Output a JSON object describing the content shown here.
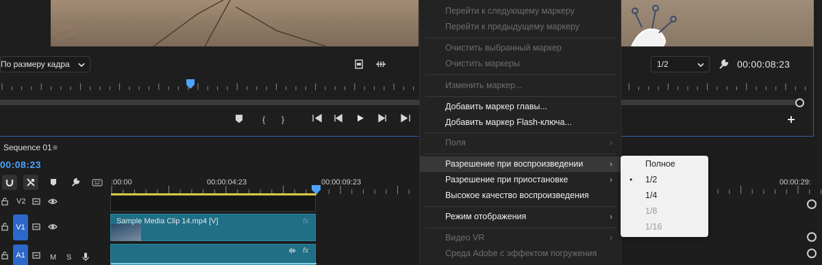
{
  "monitor": {
    "fit_dropdown": "По размеру кадра",
    "resolution_dropdown": "1/2",
    "timecode": "00:00:08:23"
  },
  "timeline": {
    "sequence_tab": "Sequence 01",
    "menu_glyph": "≡",
    "current_timecode": "00:08:23",
    "ruler_labels": [
      ":00:00",
      "00:00:04:23",
      "00:00:09:23",
      "00:00:29:"
    ],
    "tracks": [
      {
        "name": "V2"
      },
      {
        "name": "V1"
      },
      {
        "name": "A1",
        "m": "M",
        "s": "S"
      }
    ],
    "clip_title": "Sample Media Clip 14.mp4 [V]",
    "fx_label": "fx"
  },
  "context_menu": {
    "items": [
      {
        "label": "Перейти к следующему маркеру",
        "disabled": true
      },
      {
        "label": "Перейти к предыдущему маркеру",
        "disabled": true
      },
      {
        "label": "Очистить выбранный маркер",
        "disabled": true
      },
      {
        "label": "Очистить маркеры",
        "disabled": true
      },
      {
        "label": "Изменить маркер...",
        "disabled": true
      },
      {
        "label": "Добавить маркер главы...",
        "disabled": false
      },
      {
        "label": "Добавить маркер Flash-ключа...",
        "disabled": false
      },
      {
        "label": "Поля",
        "disabled": true,
        "submenu": true
      },
      {
        "label": "Разрешение при воспроизведении",
        "disabled": false,
        "submenu": true,
        "highlighted": true
      },
      {
        "label": "Разрешение при приостановке",
        "disabled": false,
        "submenu": true
      },
      {
        "label": "Высокое качество воспроизведения",
        "disabled": false
      },
      {
        "label": "Режим отображения",
        "disabled": false,
        "submenu": true
      },
      {
        "label": "Видео VR",
        "disabled": true,
        "submenu": true
      },
      {
        "label": "Среда Adobe с эффектом погружения",
        "disabled": true
      }
    ],
    "arrow_glyph": "›"
  },
  "submenu": {
    "items": [
      {
        "label": "Полное",
        "disabled": false,
        "selected": false
      },
      {
        "label": "1/2",
        "disabled": false,
        "selected": true
      },
      {
        "label": "1/4",
        "disabled": false,
        "selected": false
      },
      {
        "label": "1/8",
        "disabled": true,
        "selected": false
      },
      {
        "label": "1/16",
        "disabled": true,
        "selected": false
      }
    ],
    "bullet_glyph": "•"
  },
  "colors": {
    "accent_blue": "#4da3ff",
    "track_select": "#2c68c9",
    "clip": "#1f6f87",
    "work_area": "#d7c93f"
  }
}
